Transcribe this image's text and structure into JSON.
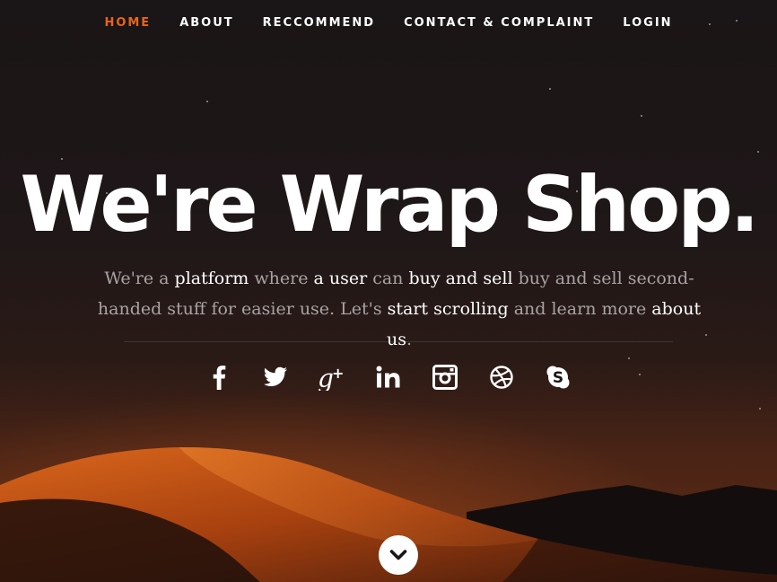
{
  "nav": {
    "items": [
      {
        "label": "HOME",
        "active": true
      },
      {
        "label": "ABOUT",
        "active": false
      },
      {
        "label": "RECCOMMEND",
        "active": false
      },
      {
        "label": "CONTACT & COMPLAINT",
        "active": false
      },
      {
        "label": "LOGIN",
        "active": false
      }
    ],
    "active_color": "#e8641e"
  },
  "hero": {
    "title": "We're Wrap Shop.",
    "tagline": {
      "t1": "We're a ",
      "b1": "platform",
      "t2": " where ",
      "b2": "a user",
      "t3": " can ",
      "b3": "buy and sell",
      "t4": " buy and sell second-handed stuff for easier use. Let's ",
      "b4": "start scrolling",
      "t5": " and learn more ",
      "b5": "about us",
      "t6": "."
    }
  },
  "social": [
    "facebook-icon",
    "twitter-icon",
    "google-plus-icon",
    "linkedin-icon",
    "instagram-icon",
    "dribbble-icon",
    "skype-icon"
  ],
  "scroll_button": {
    "icon": "chevron-down-icon"
  }
}
